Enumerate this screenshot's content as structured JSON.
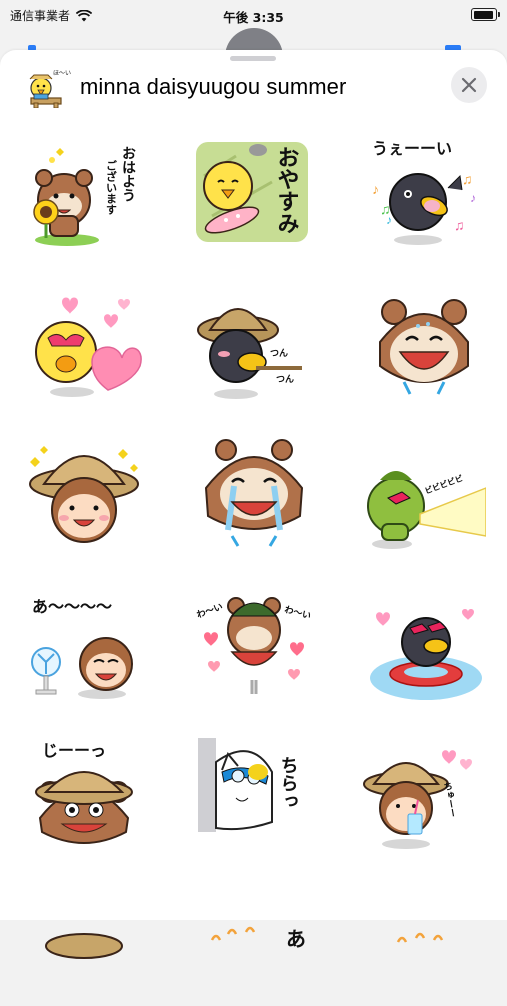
{
  "status_bar": {
    "carrier": "通信事業者",
    "time": "午後 3:35",
    "battery_level": 1.0
  },
  "sheet": {
    "title": "minna daisyuugou summer",
    "close_icon": "close-x-icon",
    "pack_icon_caption": "ほ〜い"
  },
  "stickers": [
    {
      "id": 1,
      "text": [
        "おはよう",
        "ございます"
      ],
      "subject": "tanuki-sunflower"
    },
    {
      "id": 2,
      "text": [
        "おやすみ"
      ],
      "subject": "chick-sleeping"
    },
    {
      "id": 3,
      "text": [
        "うぇーーい"
      ],
      "subject": "crow-music"
    },
    {
      "id": 4,
      "text": [],
      "subject": "chick-hearts"
    },
    {
      "id": 5,
      "text": [
        "つん",
        "つん"
      ],
      "subject": "crow-hat-poke"
    },
    {
      "id": 6,
      "text": [],
      "subject": "tanuki-laughing"
    },
    {
      "id": 7,
      "text": [],
      "subject": "monkey-hat"
    },
    {
      "id": 8,
      "text": [],
      "subject": "tanuki-crying"
    },
    {
      "id": 9,
      "text": [
        "ビビビビビ"
      ],
      "subject": "kappa-beam"
    },
    {
      "id": 10,
      "text": [
        "あ〜〜〜〜"
      ],
      "subject": "monkey-fan"
    },
    {
      "id": 11,
      "text": [
        "わ〜い",
        "わ〜い"
      ],
      "subject": "tanuki-watermelon"
    },
    {
      "id": 12,
      "text": [],
      "subject": "crow-float"
    },
    {
      "id": 13,
      "text": [
        "じーーっ"
      ],
      "subject": "tanuki-hat-stare"
    },
    {
      "id": 14,
      "text": [
        "ちらっ"
      ],
      "subject": "cat-peek"
    },
    {
      "id": 15,
      "text": [
        "ちゅーー"
      ],
      "subject": "monkey-drink"
    },
    {
      "id": 16,
      "text": [],
      "subject": "partial"
    },
    {
      "id": 17,
      "text": [
        "あ"
      ],
      "subject": "partial"
    },
    {
      "id": 18,
      "text": [],
      "subject": "partial"
    }
  ]
}
